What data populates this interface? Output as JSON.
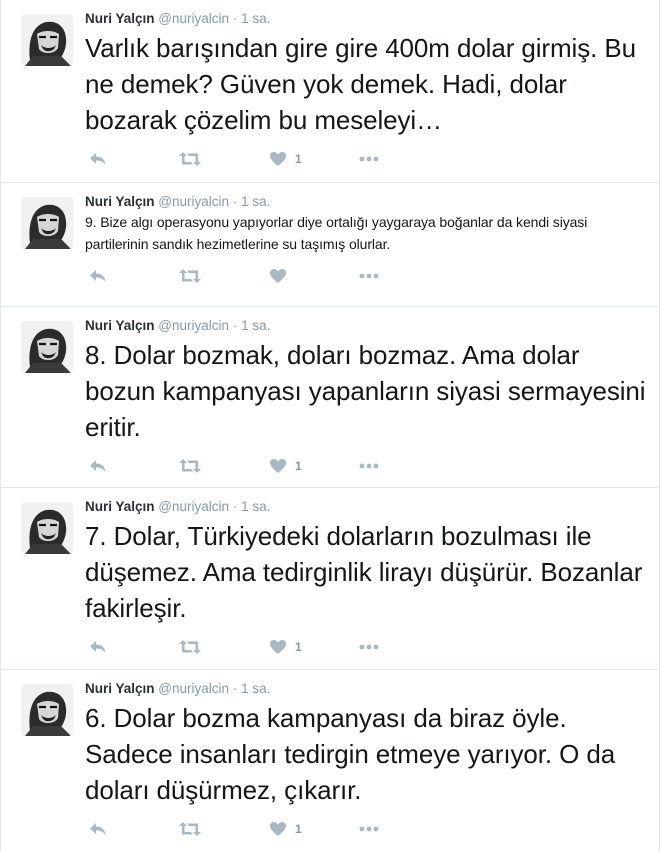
{
  "tweets": [
    {
      "author": "Nuri Yalçın",
      "handle": "@nuriyalcin",
      "separator": "·",
      "time": "1 sa.",
      "text": "Varlık barışından gire gire 400m dolar girmiş. Bu ne demek? Güven yok demek. Hadi, dolar bozarak çözelim bu meseleyi…",
      "like_count": "1",
      "large": true
    },
    {
      "author": "Nuri Yalçın",
      "handle": "@nuriyalcin",
      "separator": "·",
      "time": "1 sa.",
      "text": "9. Bize algı operasyonu yapıyorlar diye ortalığı yaygaraya boğanlar da kendi siyasi partilerinin sandık hezimetlerine su taşımış olurlar.",
      "like_count": "",
      "large": false
    },
    {
      "author": "Nuri Yalçın",
      "handle": "@nuriyalcin",
      "separator": "·",
      "time": "1 sa.",
      "text": "8. Dolar bozmak, doları bozmaz. Ama dolar bozun kampanyası yapanların siyasi sermayesini eritir.",
      "like_count": "1",
      "large": true
    },
    {
      "author": "Nuri Yalçın",
      "handle": "@nuriyalcin",
      "separator": "·",
      "time": "1 sa.",
      "text": "7. Dolar, Türkiyedeki dolarların bozulması ile düşemez. Ama tedirginlik lirayı düşürür. Bozanlar fakirleşir.",
      "like_count": "1",
      "large": true
    },
    {
      "author": "Nuri Yalçın",
      "handle": "@nuriyalcin",
      "separator": "·",
      "time": "1 sa.",
      "text": "6. Dolar bozma kampanyası da biraz öyle. Sadece insanları tedirgin etmeye yarıyor. O da doları düşürmez, çıkarır.",
      "like_count": "1",
      "large": true
    }
  ],
  "icons": {
    "reply": "reply-icon",
    "retweet": "retweet-icon",
    "like": "heart-icon",
    "more": "more-dots-icon",
    "icon_color": "#aab8c2"
  }
}
